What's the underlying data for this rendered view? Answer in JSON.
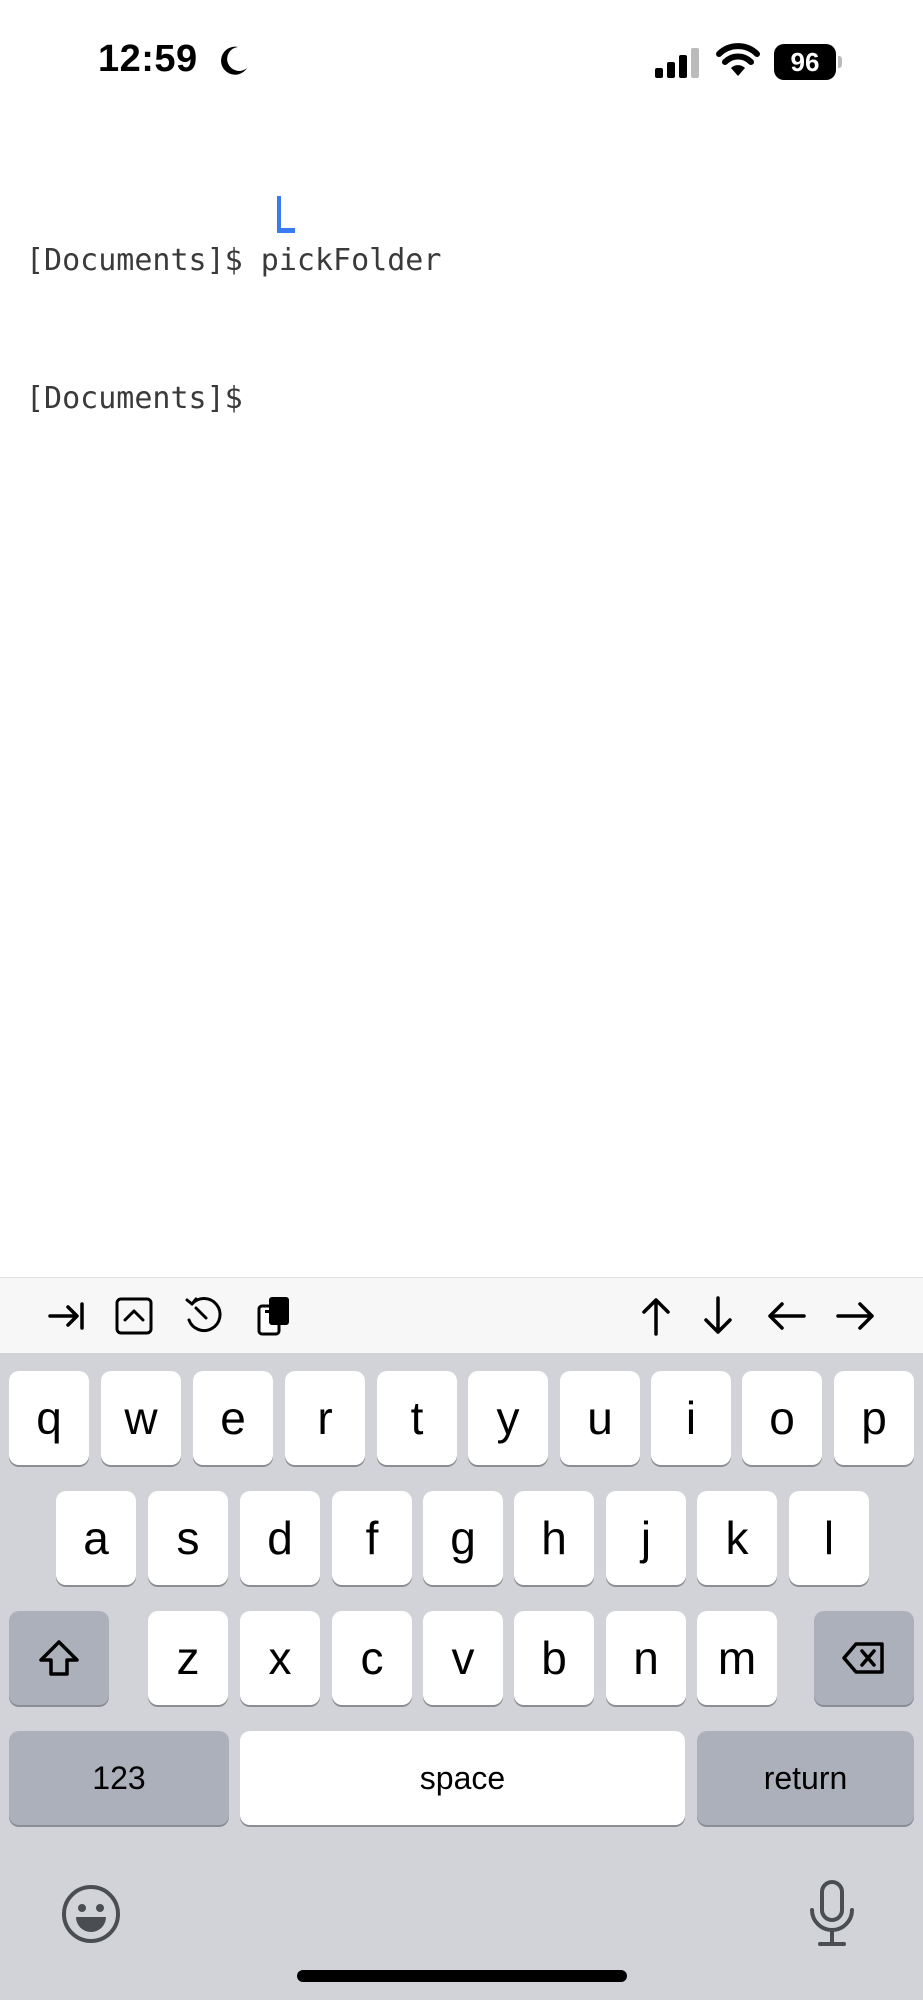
{
  "status_bar": {
    "time": "12:59",
    "battery": "96",
    "icons": [
      "moon-icon",
      "cellular-signal-icon",
      "wifi-icon",
      "battery-icon"
    ]
  },
  "terminal": {
    "lines": [
      "[Documents]$ pickFolder",
      "[Documents]$ "
    ],
    "cursor_color": "#3a7bf0"
  },
  "accessory_bar": {
    "icons": [
      "tab-icon",
      "control-key-icon",
      "history-icon",
      "paste-icon",
      "arrow-up-icon",
      "arrow-down-icon",
      "arrow-left-icon",
      "arrow-right-icon"
    ]
  },
  "keyboard": {
    "row1": [
      "q",
      "w",
      "e",
      "r",
      "t",
      "y",
      "u",
      "i",
      "o",
      "p"
    ],
    "row2": [
      "a",
      "s",
      "d",
      "f",
      "g",
      "h",
      "j",
      "k",
      "l"
    ],
    "row3": [
      "z",
      "x",
      "c",
      "v",
      "b",
      "n",
      "m"
    ],
    "numbers_label": "123",
    "space_label": "space",
    "return_label": "return",
    "icons": [
      "shift-icon",
      "delete-icon",
      "emoji-icon",
      "microphone-icon"
    ]
  }
}
